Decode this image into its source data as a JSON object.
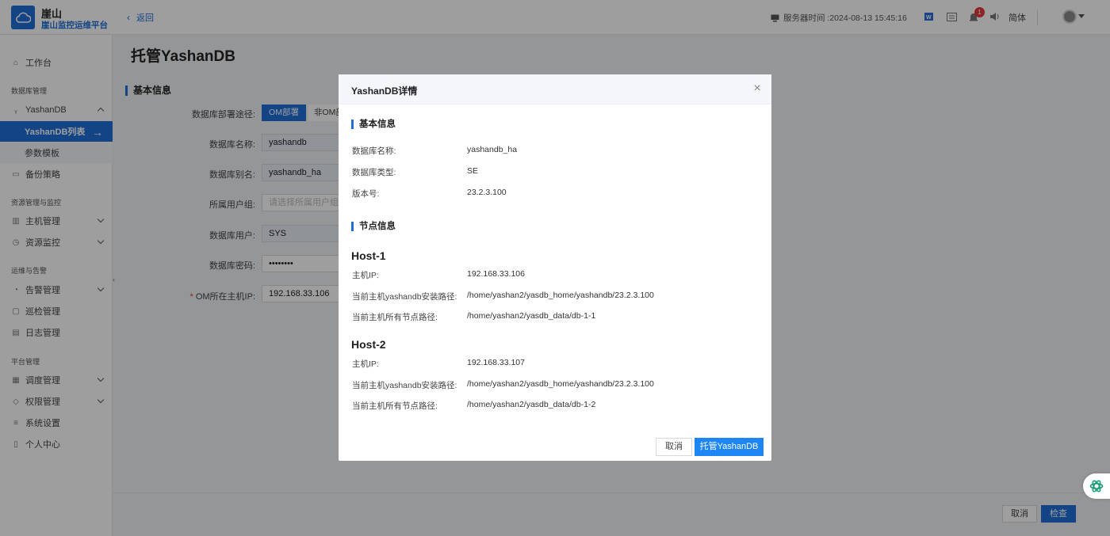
{
  "header": {
    "app_title": "崖山",
    "app_subtitle": "崖山监控运维平台",
    "back_label": "返回",
    "server_time": "服务器时间 :2024-08-13 15:45:16",
    "notification_count": "1",
    "language": "简体"
  },
  "sidebar": {
    "workbench": "工作台",
    "group_db": "数据库管理",
    "yashandb": "YashanDB",
    "yashandb_list": "YashanDB列表",
    "param_template": "参数模板",
    "backup_policy": "备份策略",
    "group_resource": "资源管理与监控",
    "host_mgmt": "主机管理",
    "resource_monitor": "资源监控",
    "group_ops": "运维与告警",
    "alarm_mgmt": "告警管理",
    "inspection_mgmt": "巡检管理",
    "log_mgmt": "日志管理",
    "group_platform": "平台管理",
    "schedule_mgmt": "调度管理",
    "permission_mgmt": "权限管理",
    "system_settings": "系统设置",
    "personal_center": "个人中心"
  },
  "main": {
    "page_title": "托管YashanDB",
    "section_title": "基本信息",
    "deploy_label": "数据库部署途径:",
    "deploy_om": "OM部署",
    "deploy_non_om": "非OM部署",
    "db_name_label": "数据库名称:",
    "db_name_value": "yashandb",
    "db_alias_label": "数据库别名:",
    "db_alias_value": "yashandb_ha",
    "user_group_label": "所属用户组:",
    "user_group_placeholder": "请选择所属用户组",
    "db_user_label": "数据库用户:",
    "db_user_value": "SYS",
    "db_password_label": "数据库密码:",
    "db_password_value": "••••••••",
    "om_host_ip_label": "OM所在主机IP:",
    "om_host_ip_value": "192.168.33.106",
    "cancel": "取消",
    "check": "检查"
  },
  "modal": {
    "title": "YashanDB详情",
    "basic_section": "基本信息",
    "db_name_label": "数据库名称:",
    "db_name_value": "yashandb_ha",
    "db_type_label": "数据库类型:",
    "db_type_value": "SE",
    "version_label": "版本号:",
    "version_value": "23.2.3.100",
    "node_section": "节点信息",
    "hosts": [
      {
        "name": "Host-1",
        "ip_label": "主机IP:",
        "ip_value": "192.168.33.106",
        "install_label": "当前主机yashandb安装路径:",
        "install_value": "/home/yashan2/yasdb_home/yashandb/23.2.3.100",
        "node_label": "当前主机所有节点路径:",
        "node_value": "/home/yashan2/yasdb_data/db-1-1"
      },
      {
        "name": "Host-2",
        "ip_label": "主机IP:",
        "ip_value": "192.168.33.107",
        "install_label": "当前主机yashandb安装路径:",
        "install_value": "/home/yashan2/yasdb_home/yashandb/23.2.3.100",
        "node_label": "当前主机所有节点路径:",
        "node_value": "/home/yashan2/yasdb_data/db-1-2"
      }
    ],
    "cancel": "取消",
    "confirm": "托管YashanDB"
  },
  "colors": {
    "accent": "#1e6fd9",
    "danger": "#e4393c"
  }
}
